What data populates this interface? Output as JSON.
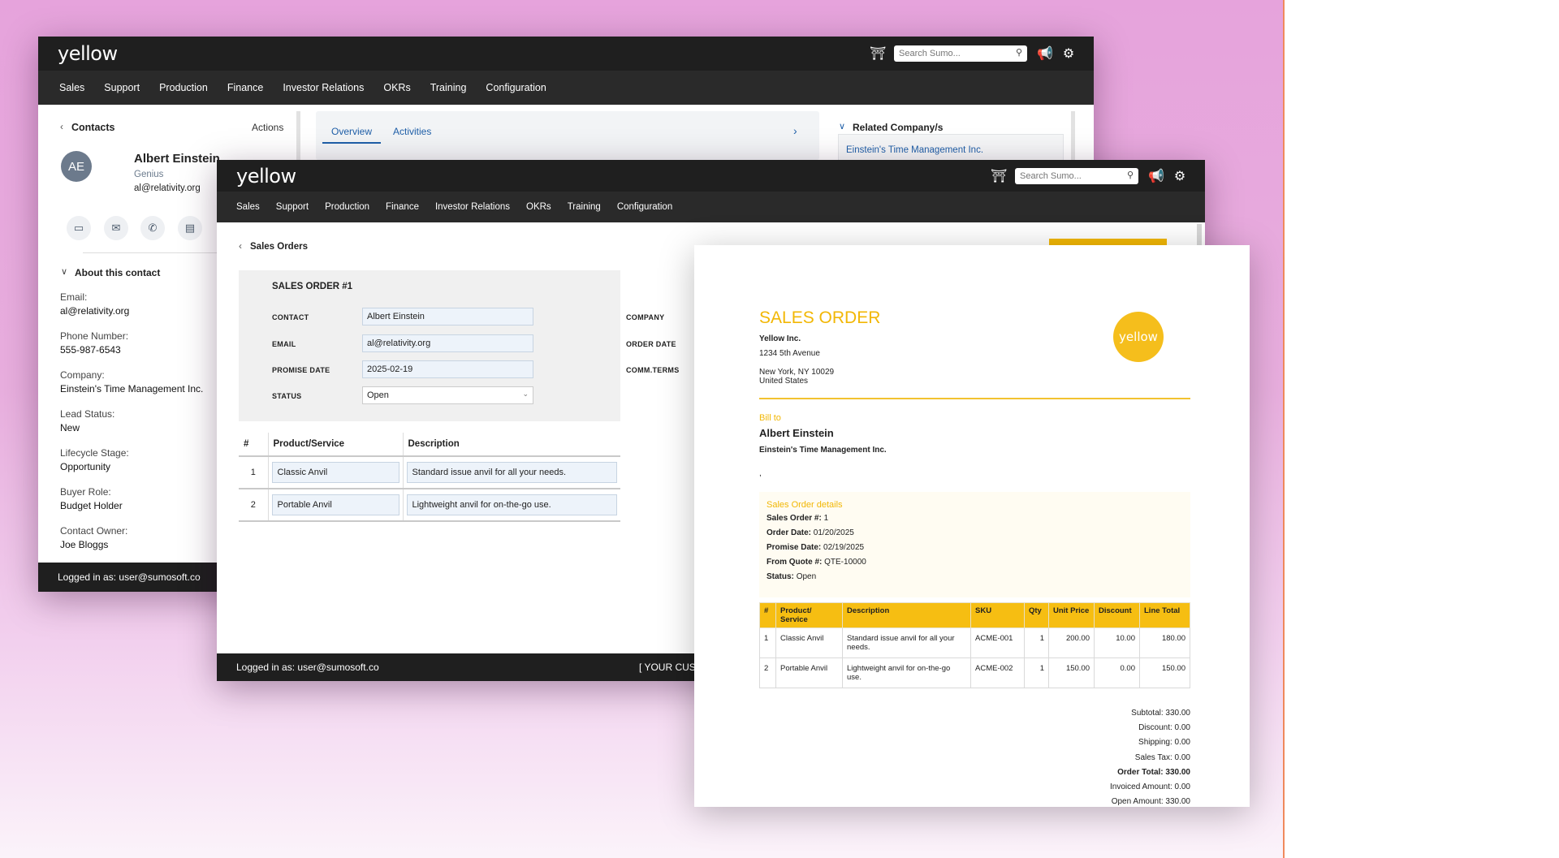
{
  "app": {
    "logo": "yellow",
    "search_placeholder": "Search Sumo...",
    "nav": [
      "Sales",
      "Support",
      "Production",
      "Finance",
      "Investor Relations",
      "OKRs",
      "Training",
      "Configuration"
    ],
    "footer_logged_in": "Logged in as: user@sumosoft.co"
  },
  "contact_window": {
    "breadcrumb": "Contacts",
    "actions": "Actions",
    "avatar_initials": "AE",
    "name": "Albert Einstein",
    "title": "Genius",
    "email": "al@relativity.org",
    "tabs": [
      "Overview",
      "Activities"
    ],
    "related_heading": "Related Company/s",
    "related_company": "Einstein's Time Management Inc.",
    "about_heading": "About this contact",
    "fields": [
      {
        "label": "Email:",
        "value": "al@relativity.org"
      },
      {
        "label": "Phone Number:",
        "value": "555-987-6543"
      },
      {
        "label": "Company:",
        "value": "Einstein's Time Management Inc."
      },
      {
        "label": "Lead Status:",
        "value": "New"
      },
      {
        "label": "Lifecycle Stage:",
        "value": "Opportunity"
      },
      {
        "label": "Buyer Role:",
        "value": "Budget Holder"
      },
      {
        "label": "Contact Owner:",
        "value": "Joe Bloggs"
      }
    ]
  },
  "order_window": {
    "breadcrumb": "Sales Orders",
    "heading": "SALES ORDER #1",
    "labels": {
      "contact": "CONTACT",
      "email": "EMAIL",
      "promise_date": "PROMISE DATE",
      "status": "STATUS",
      "company": "COMPANY",
      "order_date": "ORDER DATE",
      "comm_terms": "COMM.TERMS"
    },
    "values": {
      "contact": "Albert Einstein",
      "email": "al@relativity.org",
      "promise_date": "2025-02-19",
      "status": "Open"
    },
    "columns": [
      "#",
      "Product/Service",
      "Description"
    ],
    "rows": [
      {
        "n": "1",
        "product": "Classic Anvil",
        "description": "Standard issue anvil for all your needs."
      },
      {
        "n": "2",
        "product": "Portable Anvil",
        "description": "Lightweight anvil for on-the-go use."
      }
    ],
    "footer_right": "[ YOUR CUST"
  },
  "document": {
    "title": "SALES ORDER",
    "company_name": "Yellow Inc.",
    "address_line1": "1234 5th Avenue",
    "address_line2": "New York, NY 10029",
    "address_line3": "United States",
    "logo": "yellow",
    "bill_to_label": "Bill to",
    "bill_to_name": "Albert Einstein",
    "bill_to_company": "Einstein's Time Management Inc.",
    "bill_to_extra": ",",
    "details_heading": "Sales Order details",
    "details": [
      {
        "label": "Sales Order #:",
        "value": "1"
      },
      {
        "label": "Order Date:",
        "value": "01/20/2025"
      },
      {
        "label": "Promise Date:",
        "value": "02/19/2025"
      },
      {
        "label": "From Quote #:",
        "value": "QTE-10000"
      },
      {
        "label": "Status:",
        "value": "Open"
      }
    ],
    "columns": [
      "#",
      "Product/ Service",
      "Description",
      "SKU",
      "Qty",
      "Unit Price",
      "Discount",
      "Line Total"
    ],
    "rows": [
      {
        "n": "1",
        "product": "Classic Anvil",
        "description": "Standard issue anvil for all your needs.",
        "sku": "ACME-001",
        "qty": "1",
        "unit": "200.00",
        "discount": "10.00",
        "total": "180.00"
      },
      {
        "n": "2",
        "product": "Portable Anvil",
        "description": "Lightweight anvil for on-the-go use.",
        "sku": "ACME-002",
        "qty": "1",
        "unit": "150.00",
        "discount": "0.00",
        "total": "150.00"
      }
    ],
    "totals": [
      {
        "text": "Subtotal: 330.00"
      },
      {
        "text": "Discount: 0.00"
      },
      {
        "text": "Shipping: 0.00"
      },
      {
        "text": "Sales Tax: 0.00"
      },
      {
        "text": "Order Total: 330.00",
        "bold": true
      },
      {
        "text": "Invoiced Amount: 0.00"
      },
      {
        "text": "Open Amount: 330.00"
      }
    ]
  },
  "colors": {
    "accent": "#f5be1c",
    "nav": "#1f1f1f",
    "link": "#1f5fa8",
    "background": "#e6a3dc"
  }
}
